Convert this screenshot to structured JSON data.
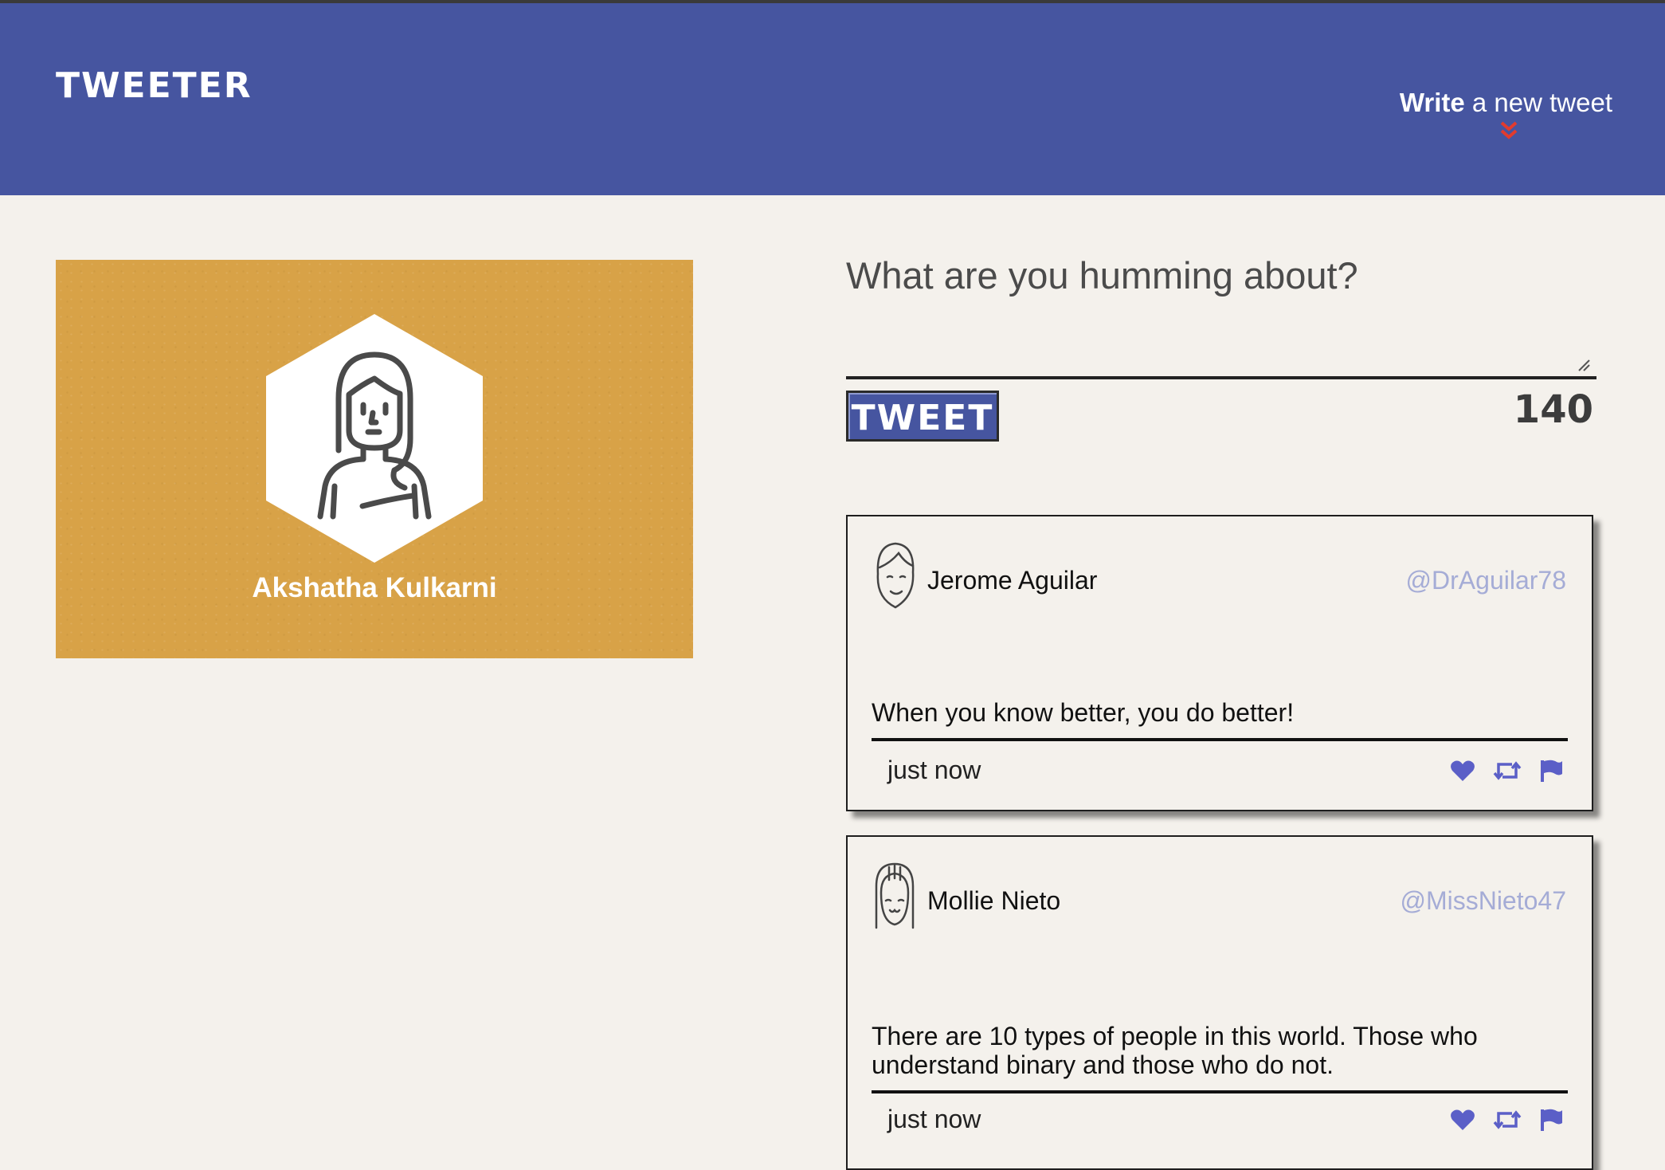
{
  "nav": {
    "brand": "TWEETER",
    "compose_bold": "Write",
    "compose_rest": " a new tweet",
    "accent_color": "#e23b2e"
  },
  "profile": {
    "name": "Akshatha Kulkarni",
    "card_color": "#d8a247"
  },
  "composer": {
    "prompt": "What are you humming about?",
    "input_value": "",
    "button_label": "TWEET",
    "char_count": "140"
  },
  "tweets": [
    {
      "name": "Jerome Aguilar",
      "handle": "@DrAguilar78",
      "body": "When you know better, you do better!",
      "time": "just now",
      "icons": [
        "heart-icon",
        "retweet-icon",
        "flag-icon"
      ]
    },
    {
      "name": "Mollie Nieto",
      "handle": "@MissNieto47",
      "body": "There are 10 types of people in this world. Those who understand binary and those who do not.",
      "time": "just now",
      "icons": [
        "heart-icon",
        "retweet-icon",
        "flag-icon"
      ]
    }
  ],
  "colors": {
    "nav": "#4655a0",
    "background": "#f4f1ec",
    "action_icons": "#5b5fc7",
    "handle": "#a5acd6"
  }
}
